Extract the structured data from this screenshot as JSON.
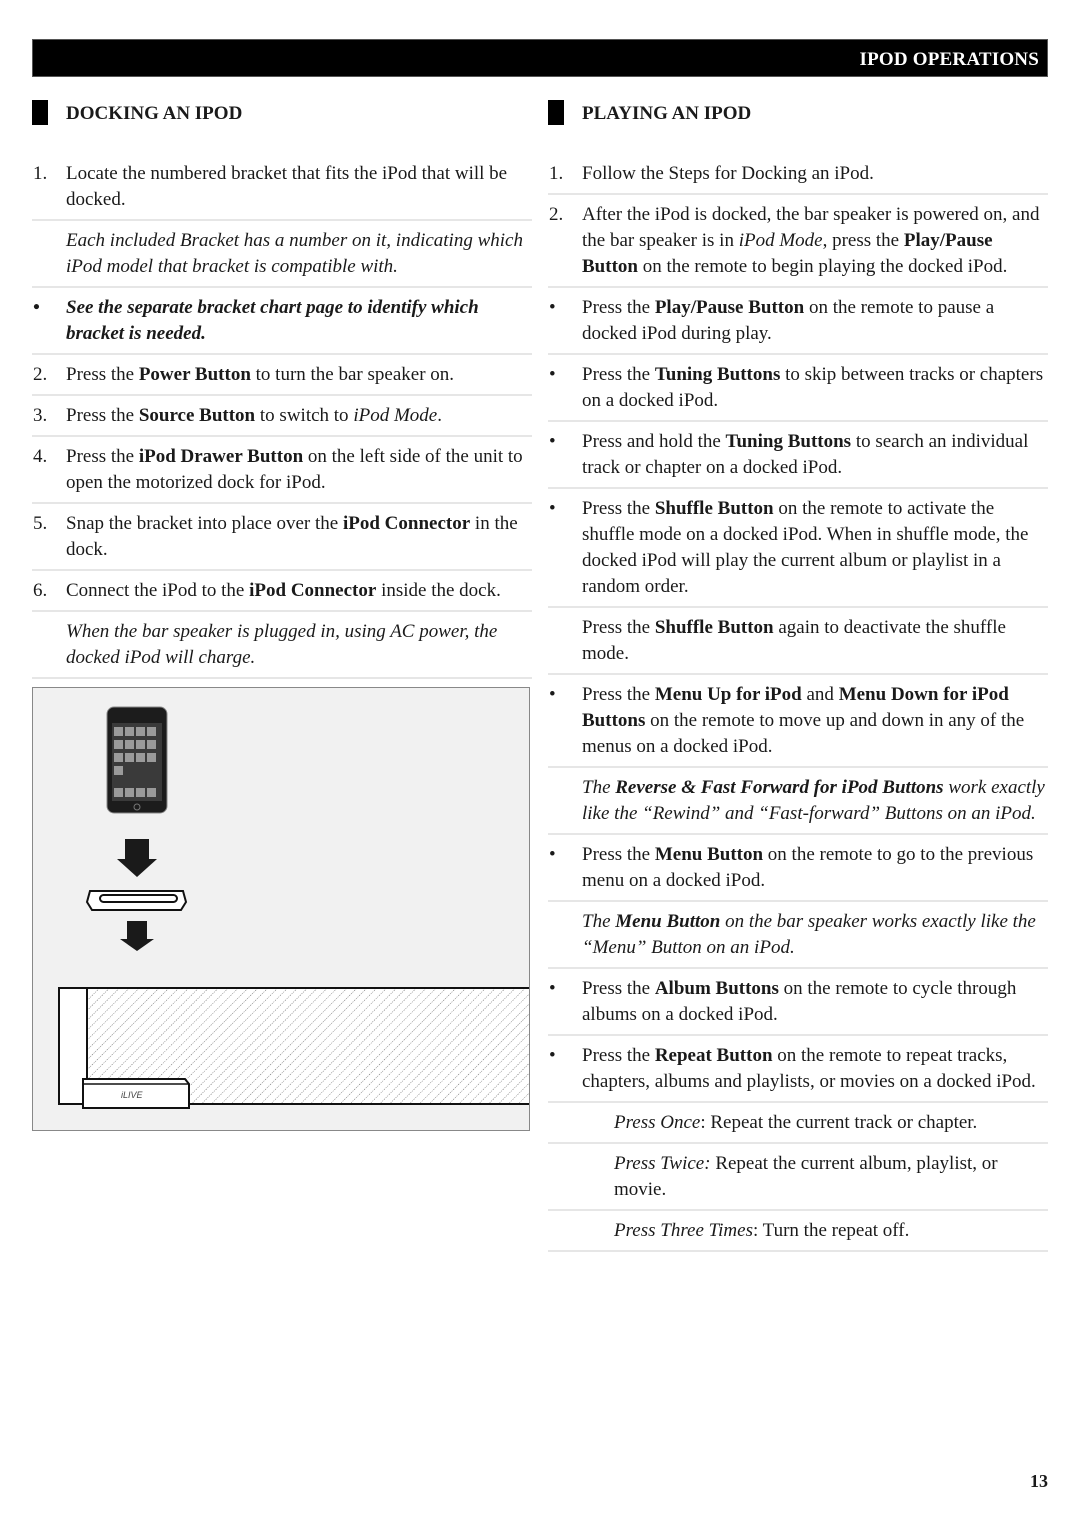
{
  "header": {
    "title": "IPOD OPERATIONS"
  },
  "left": {
    "title": "DOCKING AN IPOD",
    "items": [
      {
        "type": "step",
        "marker": "1.",
        "runs": [
          {
            "t": "Locate the numbered bracket that fits the iPod that will be docked."
          }
        ]
      },
      {
        "type": "note",
        "marker": "",
        "runs": [
          {
            "t": "Each included Bracket has a number on it, indicating which iPod model that bracket is compatible with."
          }
        ]
      },
      {
        "type": "strongnote",
        "marker": "•",
        "runs": [
          {
            "t": "See the separate bracket chart page to identify which bracket is needed."
          }
        ]
      },
      {
        "type": "step",
        "marker": "2.",
        "runs": [
          {
            "t": "Press the "
          },
          {
            "t": "Power Button",
            "s": "b"
          },
          {
            "t": " to turn the bar speaker on."
          }
        ]
      },
      {
        "type": "step",
        "marker": "3.",
        "runs": [
          {
            "t": "Press the "
          },
          {
            "t": "Source Button",
            "s": "b"
          },
          {
            "t": " to switch to "
          },
          {
            "t": "iPod Mode",
            "s": "i"
          },
          {
            "t": "."
          }
        ]
      },
      {
        "type": "step",
        "marker": "4.",
        "runs": [
          {
            "t": "Press the "
          },
          {
            "t": "iPod Drawer Button",
            "s": "b"
          },
          {
            "t": " on the left side of the unit to open the motorized dock for iPod."
          }
        ]
      },
      {
        "type": "step",
        "marker": "5.",
        "runs": [
          {
            "t": "Snap the bracket into place over the "
          },
          {
            "t": "iPod Connector",
            "s": "b"
          },
          {
            "t": " in the dock."
          }
        ]
      },
      {
        "type": "step",
        "marker": "6.",
        "runs": [
          {
            "t": "Connect the iPod to the "
          },
          {
            "t": "iPod Connector",
            "s": "b"
          },
          {
            "t": " inside the dock."
          }
        ]
      },
      {
        "type": "note",
        "marker": "",
        "runs": [
          {
            "t": "When the bar speaker is plugged in, using AC power, the docked iPod will charge."
          }
        ]
      }
    ],
    "figure": {
      "brand_logo": "iLIVE"
    }
  },
  "right": {
    "title": "PLAYING AN IPOD",
    "items": [
      {
        "type": "step",
        "marker": "1.",
        "runs": [
          {
            "t": "Follow the Steps for Docking an iPod."
          }
        ]
      },
      {
        "type": "step",
        "marker": "2.",
        "runs": [
          {
            "t": "After the iPod is docked, the bar speaker is powered on, and the bar speaker is in "
          },
          {
            "t": "iPod Mode",
            "s": "i"
          },
          {
            "t": ", press the "
          },
          {
            "t": "Play/Pause Button",
            "s": "b"
          },
          {
            "t": " on the remote to begin playing the docked iPod."
          }
        ]
      },
      {
        "type": "step",
        "marker": "•",
        "runs": [
          {
            "t": "Press the "
          },
          {
            "t": "Play/Pause Button",
            "s": "b"
          },
          {
            "t": " on the remote to pause a docked iPod during play."
          }
        ]
      },
      {
        "type": "step",
        "marker": "•",
        "runs": [
          {
            "t": "Press the "
          },
          {
            "t": "Tuning Buttons",
            "s": "b"
          },
          {
            "t": " to skip between tracks or chapters on a docked iPod."
          }
        ]
      },
      {
        "type": "step",
        "marker": "•",
        "runs": [
          {
            "t": "Press and hold the "
          },
          {
            "t": "Tuning Buttons",
            "s": "b"
          },
          {
            "t": " to search an individual track or chapter on a docked iPod."
          }
        ]
      },
      {
        "type": "step",
        "marker": "•",
        "runs": [
          {
            "t": "Press the "
          },
          {
            "t": "Shuffle Button",
            "s": "b"
          },
          {
            "t": " on the remote to activate the shuffle mode on a docked iPod. When in shuffle mode, the docked iPod will play the current album or playlist in a random order."
          }
        ]
      },
      {
        "type": "step",
        "marker": "",
        "runs": [
          {
            "t": "Press the "
          },
          {
            "t": "Shuffle Button",
            "s": "b"
          },
          {
            "t": " again to deactivate the shuffle mode."
          }
        ]
      },
      {
        "type": "step",
        "marker": "•",
        "runs": [
          {
            "t": "Press the "
          },
          {
            "t": "Menu Up for iPod",
            "s": "b"
          },
          {
            "t": " and "
          },
          {
            "t": "Menu Down for iPod Buttons",
            "s": "b"
          },
          {
            "t": " on the remote to move up and down in any of the menus on a docked iPod."
          }
        ]
      },
      {
        "type": "note",
        "marker": "",
        "runs": [
          {
            "t": "The "
          },
          {
            "t": "Reverse & Fast Forward for iPod Buttons",
            "s": "b"
          },
          {
            "t": " work exactly like the “Rewind” and “Fast-forward” Buttons on an iPod."
          }
        ]
      },
      {
        "type": "step",
        "marker": "•",
        "runs": [
          {
            "t": "Press the "
          },
          {
            "t": "Menu Button",
            "s": "b"
          },
          {
            "t": " on the remote to go to the previous menu on a docked iPod."
          }
        ]
      },
      {
        "type": "note",
        "marker": "",
        "runs": [
          {
            "t": "The "
          },
          {
            "t": "Menu Button",
            "s": "b"
          },
          {
            "t": " on the bar speaker works exactly like the “Menu” Button on an iPod."
          }
        ]
      },
      {
        "type": "step",
        "marker": "•",
        "runs": [
          {
            "t": "Press the "
          },
          {
            "t": "Album Buttons",
            "s": "b"
          },
          {
            "t": " on the remote to cycle through albums on a docked iPod."
          }
        ]
      },
      {
        "type": "step",
        "marker": "•",
        "runs": [
          {
            "t": "Press the "
          },
          {
            "t": "Repeat Button",
            "s": "b"
          },
          {
            "t": " on the remote to repeat tracks, chapters, albums and playlists, or movies on a docked iPod."
          }
        ]
      },
      {
        "type": "sub",
        "marker": "",
        "runs": [
          {
            "t": "Press Once",
            "s": "i"
          },
          {
            "t": ": Repeat the current track or chapter."
          }
        ]
      },
      {
        "type": "sub",
        "marker": "",
        "runs": [
          {
            "t": "Press Twice:",
            "s": "i"
          },
          {
            "t": " Repeat the current album, playlist, or movie."
          }
        ]
      },
      {
        "type": "sub",
        "marker": "",
        "runs": [
          {
            "t": "Press Three Times",
            "s": "i"
          },
          {
            "t": ": Turn the repeat off."
          }
        ]
      }
    ]
  },
  "footer": {
    "page_number": "13"
  }
}
